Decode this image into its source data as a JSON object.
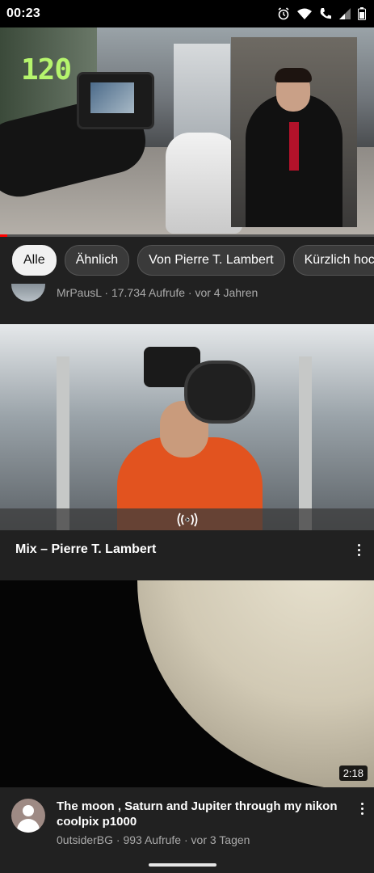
{
  "status_bar": {
    "time": "00:23",
    "icons": [
      "alarm-icon",
      "wifi-icon",
      "phone-icon",
      "signal-icon",
      "battery-icon"
    ]
  },
  "player": {
    "overlay_number": "120",
    "progress_fraction": 0.02
  },
  "chips": [
    "Alle",
    "Ähnlich",
    "Von Pierre T. Lambert",
    "Kürzlich hoch"
  ],
  "previous_video": {
    "meta": "MrPausL · 17.734 Aufrufe · vor 4 Jahren"
  },
  "mix": {
    "title": "Mix – Pierre T. Lambert",
    "icon": "mix-radio-icon"
  },
  "video": {
    "duration": "2:18",
    "title": "The moon , Saturn and Jupiter through my nikon coolpix p1000",
    "meta": "0utsiderBG · 993 Aufrufe · vor 3 Tagen"
  },
  "colors": {
    "background": "#212121",
    "accent": "#ff0000",
    "chip_active_bg": "#f1f1f1"
  }
}
